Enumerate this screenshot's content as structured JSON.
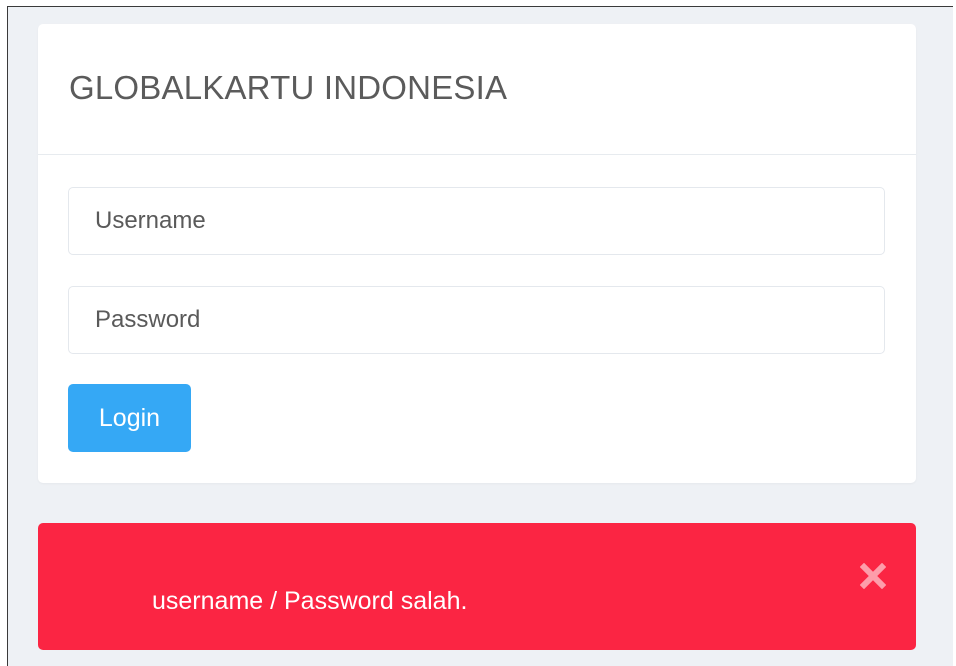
{
  "login_card": {
    "title": "GLOBALKARTU INDONESIA",
    "username_placeholder": "Username",
    "password_placeholder": "Password",
    "login_label": "Login"
  },
  "alert": {
    "message": "username / Password salah.",
    "close_icon": "close-icon",
    "background_color": "#fb2543"
  },
  "colors": {
    "accent": "#35a8f5",
    "page_background": "#eef1f5"
  }
}
